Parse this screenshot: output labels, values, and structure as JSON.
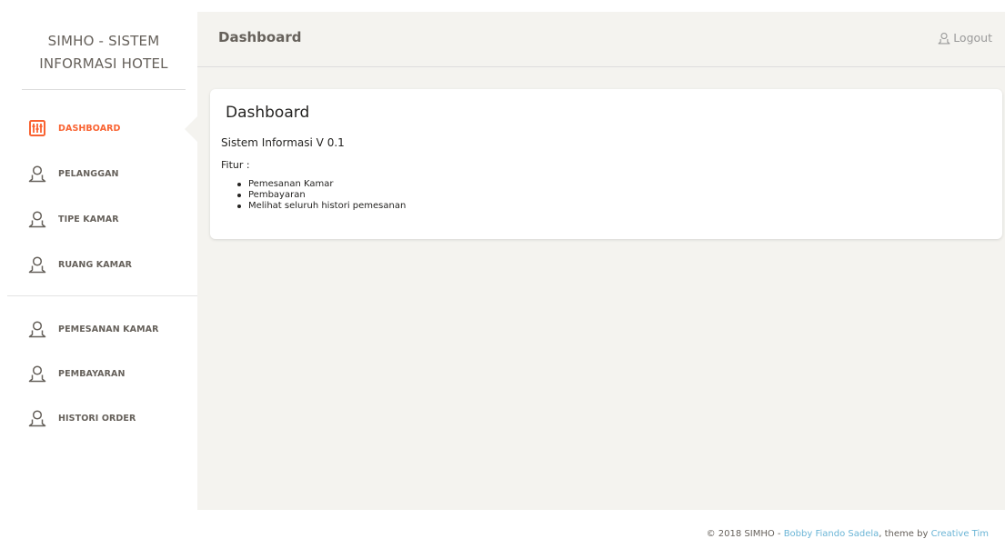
{
  "sidebar": {
    "brand_line1": "SIMHO - SISTEM",
    "brand_line2": "INFORMASI HOTEL",
    "items": [
      {
        "label": "DASHBOARD",
        "icon": "panel-icon",
        "active": true
      },
      {
        "label": "PELANGGAN",
        "icon": "user-icon",
        "active": false
      },
      {
        "label": "TIPE KAMAR",
        "icon": "user-icon",
        "active": false
      },
      {
        "label": "RUANG KAMAR",
        "icon": "user-icon",
        "active": false
      },
      {
        "label": "PEMESANAN KAMAR",
        "icon": "user-icon",
        "active": false
      },
      {
        "label": "PEMBAYARAN",
        "icon": "user-icon",
        "active": false
      },
      {
        "label": "HISTORI ORDER",
        "icon": "user-icon",
        "active": false
      }
    ]
  },
  "topbar": {
    "title": "Dashboard",
    "logout_label": "Logout"
  },
  "card": {
    "title": "Dashboard",
    "version": "Sistem Informasi V 0.1",
    "fitur_label": "Fitur :",
    "features": [
      "Pemesanan Kamar",
      "Pembayaran",
      "Melihat seluruh histori pemesanan"
    ]
  },
  "footer": {
    "prefix": "© 2018 SIMHO - ",
    "author": "Bobby Fiando Sadela",
    "middle": ", theme by ",
    "theme": "Creative Tim"
  },
  "colors": {
    "accent": "#f96332",
    "background": "#f4f3ef",
    "link": "#6bb5d6"
  }
}
